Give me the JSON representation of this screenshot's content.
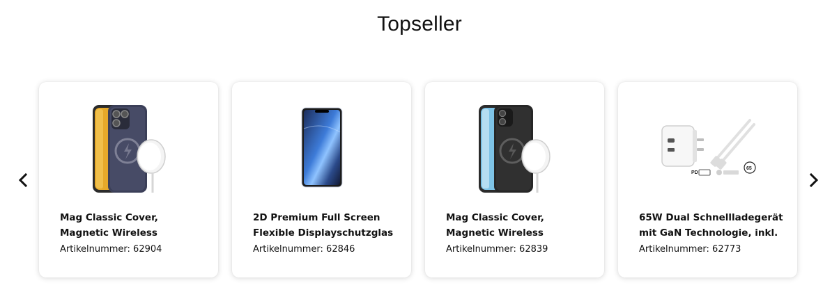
{
  "section": {
    "title": "Topseller"
  },
  "nav": {
    "prev_icon": "chevron-left-icon",
    "next_icon": "chevron-right-icon"
  },
  "products": [
    {
      "image": "phone-case-with-magsafe-charger",
      "name_line1": "Mag Classic Cover,",
      "name_line2": "Magnetic Wireless",
      "sku": "Artikelnummer: 62904"
    },
    {
      "image": "screen-protector-glass",
      "name_line1": "2D Premium Full Screen",
      "name_line2": "Flexible Displayschutzglas",
      "sku": "Artikelnummer: 62846"
    },
    {
      "image": "phone-case-with-magsafe-charger",
      "name_line1": "Mag Classic Cover,",
      "name_line2": "Magnetic Wireless",
      "sku": "Artikelnummer: 62839"
    },
    {
      "image": "usb-c-charger-with-cable",
      "name_line1": "65W Dual Schnellladegerät",
      "name_line2": "mit GaN Technologie, inkl.",
      "sku": "Artikelnummer: 62773",
      "badge_pd": "PD",
      "badge_watt": "65"
    }
  ]
}
